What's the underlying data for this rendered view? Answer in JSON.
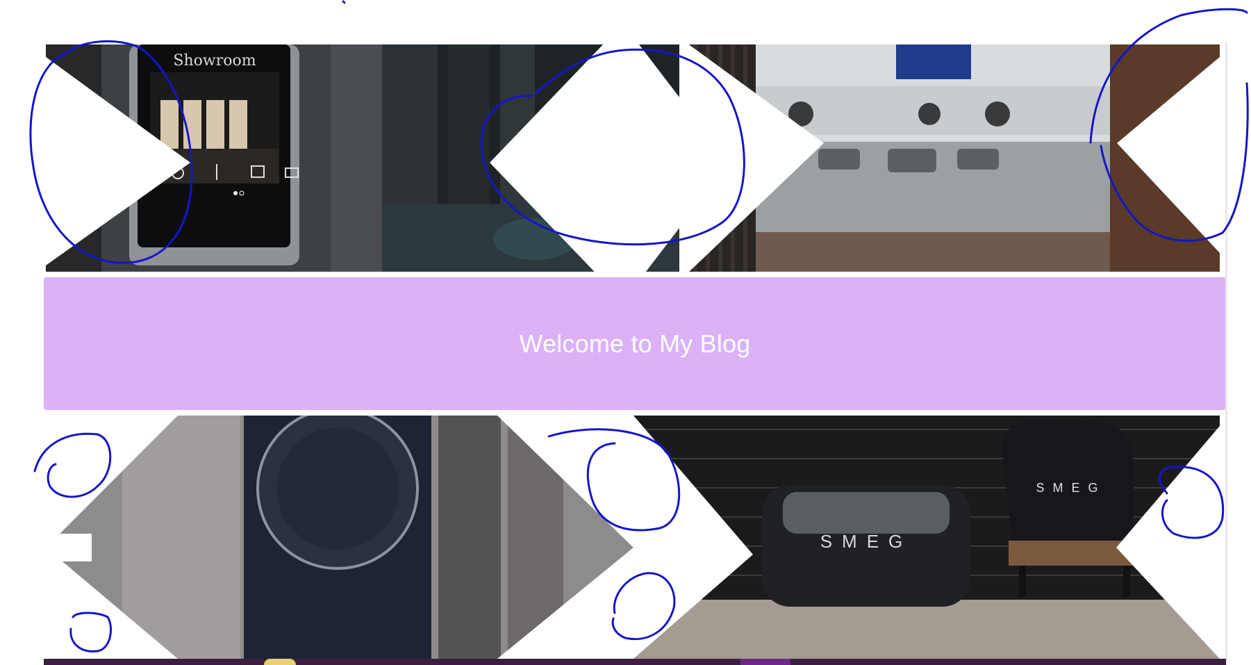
{
  "banner": {
    "title": "Welcome to My Blog"
  },
  "tiles": {
    "showroom_screen": {
      "label": "Showroom"
    },
    "toaster": {
      "brand": "SMEG"
    },
    "kettle": {
      "brand": "SMEG"
    }
  },
  "colors": {
    "banner": "#dab2f5",
    "annotation": "#1515c8",
    "footer": "#3b1f3f"
  }
}
